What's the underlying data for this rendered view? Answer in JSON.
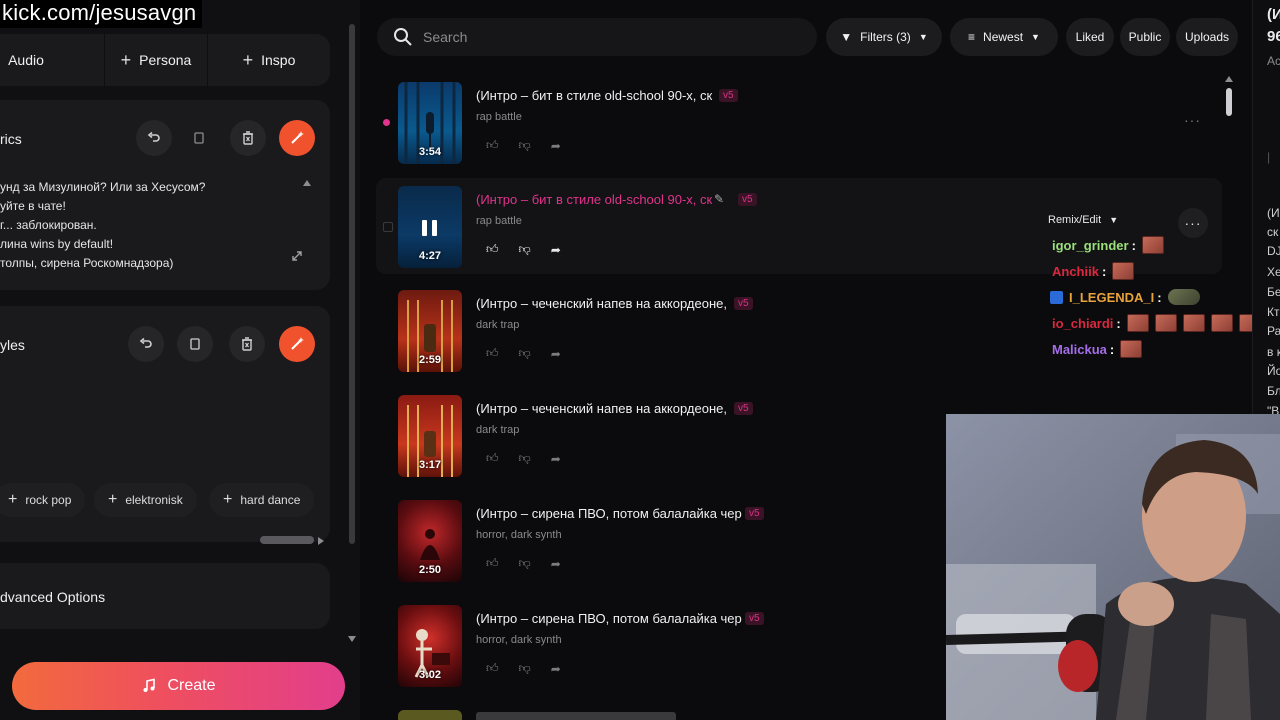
{
  "overlay": {
    "url": "kick.com/jesusavgn"
  },
  "left": {
    "tabs": [
      {
        "label": "Audio",
        "plus": false
      },
      {
        "label": "Persona",
        "plus": true
      },
      {
        "label": "Inspo",
        "plus": true
      }
    ],
    "lyrics": {
      "title": "rics",
      "lines": [
        "унд за Мизулиной? Или за Хесусом?",
        "уйте в чате!",
        "г... заблокирован.",
        "лина wins by default!",
        "толпы, сирена Роскомнадзора)"
      ]
    },
    "styles": {
      "title": "yles",
      "chips": [
        "rock pop",
        "elektronisk",
        "hard dance"
      ]
    },
    "advanced": "dvanced Options",
    "create": "Create"
  },
  "topbar": {
    "search_placeholder": "Search",
    "filters": "Filters (3)",
    "sort": "Newest",
    "buttons": [
      "Liked",
      "Public",
      "Uploads"
    ]
  },
  "songs": [
    {
      "title": "(Интро – бит в стиле old-school 90-х, ск",
      "version": "v5",
      "tags": "rap battle",
      "duration": "3:54",
      "highlight": false
    },
    {
      "title": "(Интро – бит в стиле old-school 90-х, ск",
      "version": "v5",
      "tags": "rap battle",
      "duration": "4:27",
      "highlight": true
    },
    {
      "title": "(Интро – чеченский напев на аккордеоне,",
      "version": "v5",
      "tags": "dark trap",
      "duration": "2:59",
      "highlight": false
    },
    {
      "title": "(Интро – чеченский напев на аккордеоне,",
      "version": "v5",
      "tags": "dark trap",
      "duration": "3:17",
      "highlight": false
    },
    {
      "title": "(Интро – сирена ПВО, потом балалайка чер",
      "version": "v5",
      "tags": "horror, dark synth",
      "duration": "2:50",
      "highlight": false
    },
    {
      "title": "(Интро – сирена ПВО, потом балалайка чер",
      "version": "v5",
      "tags": "horror, dark synth",
      "duration": "3:02",
      "highlight": false
    }
  ],
  "remix_label": "Remix/Edit",
  "chat": [
    {
      "user": "igor_grinder",
      "color": "#9be07a",
      "emotes": [
        "pig"
      ]
    },
    {
      "user": "Anchiik",
      "color": "#d9283f",
      "emotes": [
        "pig"
      ]
    },
    {
      "user": "I_LEGENDA_I",
      "color": "#e8a33a",
      "emotes": [
        "tank"
      ],
      "badge": true
    },
    {
      "user": "io_chiardi",
      "color": "#d9283f",
      "emotes": [
        "pig",
        "pig",
        "pig",
        "pig",
        "pig"
      ]
    },
    {
      "user": "Malickua",
      "color": "#a56ee8",
      "emotes": [
        "pig"
      ]
    }
  ],
  "right_panel": {
    "top": [
      "(И",
      "96",
      "Ac"
    ],
    "lines": [
      "(И",
      "ск",
      "DJ",
      "Хе",
      "Бе",
      "Кт",
      "Ра",
      "в к",
      "Йо",
      "Бл",
      "\"В"
    ]
  },
  "colors": {
    "accent_pink": "#e0338c",
    "accent_orange": "#f0522d",
    "background": "#0b0b0d"
  }
}
